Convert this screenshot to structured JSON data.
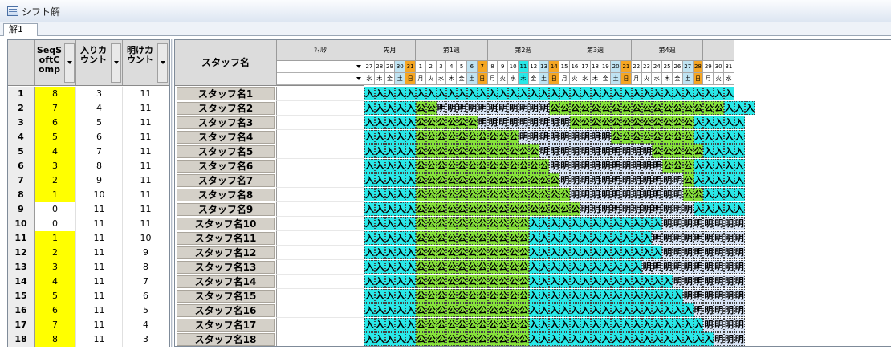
{
  "window": {
    "title": "シフト解",
    "tab": "解1"
  },
  "left": {
    "headers": [
      "SeqS\noftC\nomp",
      "入りカ\nウント",
      "明けカ\nウント"
    ],
    "rows": [
      {
        "n": "1",
        "seq": "8",
        "iri": "3",
        "ake": "11"
      },
      {
        "n": "2",
        "seq": "7",
        "iri": "4",
        "ake": "11"
      },
      {
        "n": "3",
        "seq": "6",
        "iri": "5",
        "ake": "11"
      },
      {
        "n": "4",
        "seq": "5",
        "iri": "6",
        "ake": "11"
      },
      {
        "n": "5",
        "seq": "4",
        "iri": "7",
        "ake": "11"
      },
      {
        "n": "6",
        "seq": "3",
        "iri": "8",
        "ake": "11"
      },
      {
        "n": "7",
        "seq": "2",
        "iri": "9",
        "ake": "11"
      },
      {
        "n": "8",
        "seq": "1",
        "iri": "10",
        "ake": "11"
      },
      {
        "n": "9",
        "seq": "0",
        "iri": "11",
        "ake": "11"
      },
      {
        "n": "10",
        "seq": "0",
        "iri": "11",
        "ake": "11"
      },
      {
        "n": "11",
        "seq": "1",
        "iri": "11",
        "ake": "10"
      },
      {
        "n": "12",
        "seq": "2",
        "iri": "11",
        "ake": "9"
      },
      {
        "n": "13",
        "seq": "3",
        "iri": "11",
        "ake": "8"
      },
      {
        "n": "14",
        "seq": "4",
        "iri": "11",
        "ake": "7"
      },
      {
        "n": "15",
        "seq": "5",
        "iri": "11",
        "ake": "6"
      },
      {
        "n": "16",
        "seq": "6",
        "iri": "11",
        "ake": "5"
      },
      {
        "n": "17",
        "seq": "7",
        "iri": "11",
        "ake": "4"
      },
      {
        "n": "18",
        "seq": "8",
        "iri": "11",
        "ake": "3"
      }
    ]
  },
  "grid": {
    "staff_header": "スタッフ名",
    "filter_header": "ﾌｨﾙﾀ",
    "weeks": [
      {
        "label": "先月",
        "days": 5
      },
      {
        "label": "第1週",
        "days": 7
      },
      {
        "label": "第2週",
        "days": 7
      },
      {
        "label": "第3週",
        "days": 7
      },
      {
        "label": "第4週",
        "days": 7
      },
      {
        "label": "",
        "days": 3
      }
    ],
    "days": [
      "27",
      "28",
      "29",
      "30",
      "31",
      "1",
      "2",
      "3",
      "4",
      "5",
      "6",
      "7",
      "8",
      "9",
      "10",
      "11",
      "12",
      "13",
      "14",
      "15",
      "16",
      "17",
      "18",
      "19",
      "20",
      "21",
      "22",
      "23",
      "24",
      "25",
      "26",
      "27",
      "28",
      "29",
      "30",
      "31"
    ],
    "dows": [
      "水",
      "木",
      "金",
      "土",
      "日",
      "月",
      "火",
      "水",
      "木",
      "金",
      "土",
      "日",
      "月",
      "火",
      "水",
      "木",
      "金",
      "土",
      "日",
      "月",
      "火",
      "水",
      "木",
      "金",
      "土",
      "日",
      "月",
      "火",
      "水",
      "木",
      "金",
      "土",
      "日",
      "月",
      "火",
      "水"
    ],
    "colors": {
      "in": "#29e8e8",
      "ake": "#d8e4f5",
      "ko": "#86e23a",
      "sat": "#bfe3f2",
      "sun": "#f5a623",
      "today": "#29e8e8"
    },
    "staff": [
      "スタッフ名1",
      "スタッフ名2",
      "スタッフ名3",
      "スタッフ名4",
      "スタッフ名5",
      "スタッフ名6",
      "スタッフ名7",
      "スタッフ名8",
      "スタッフ名9",
      "スタッフ名10",
      "スタッフ名11",
      "スタッフ名12",
      "スタッフ名13",
      "スタッフ名14",
      "スタッフ名15",
      "スタッフ名16",
      "スタッフ名17",
      "スタッフ名18"
    ],
    "rows": [
      "入入入入入入入入入入入入入入入入入入入入入入入入入入入入入入入入入入入入",
      "入入入入入公公明明明明明明明明明明明公公公公公公公公公公公公公公公公公入入入",
      "入入入入入公公公公公公明明明明明明明明明公公公公公公公公公公公公入入入入入",
      "入入入入入公公公公公公公公公公明明明明明明明明明公公公公公公公公入入入入入",
      "入入入入入公公公公公公公公公公公公明明明明明明明明明明明公公公公公入入入入",
      "入入入入入公公公公公公公公公公公公公明明明明明明明明明明明公公公入入入入入",
      "入入入入入公公公公公公公公公公公公公公明明明明明明明明明明明明公入入入入入",
      "入入入入入公公公公公公公公公公公公公公公明明明明明明明明明明明公公入入入入",
      "入入入入入公公公公公公公公公公公公公公公公明明明明明明明明明明明入入入入入",
      "入入入入入公公公公公公公公公公公入入入入入入入入入入入入入明明明明明明明明",
      "入入入入入公公公公公公公公公公公入入入入入入入入入入入入明明明明明明明明明",
      "入入入入入公公公公公公公公公公公入入入入入入入入入入入入入明明明明明明明明",
      "入入入入入公公公公公公公公公公公入入入入入入入入入入入明明明明明明明明明明",
      "入入入入入公公公公公公公公公公公入入入入入入入入入入入入入入明明明明明明明",
      "入入入入入公公公公公公公公公公公入入入入入入入入入入入入入入入明明明明明明",
      "入入入入入公公公公公公公公公公公入入入入入入入入入入入入入入入入明明明明明",
      "入入入入入公公公公公公公公公公公入入入入入入入入入入入入入入入入入明明明明",
      "入入入入入公公公公公公公公公公公入入入入入入入入入入入入入入入入入入明明明"
    ]
  }
}
